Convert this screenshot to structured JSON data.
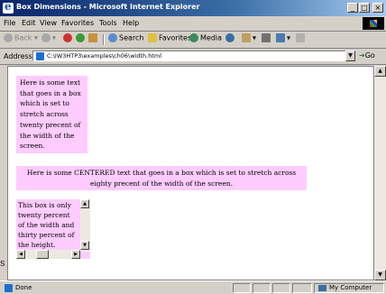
{
  "window": {
    "title": "Box Dimensions - Microsoft Internet Explorer",
    "controls": {
      "minimize": "_",
      "maximize": "□",
      "close": "×"
    }
  },
  "menu": [
    "File",
    "Edit",
    "View",
    "Favorites",
    "Tools",
    "Help"
  ],
  "toolbar": {
    "back": "Back",
    "search": "Search",
    "favorites": "Favorites",
    "media": "Media"
  },
  "address": {
    "label": "Address",
    "url": "C:\\IW3HTP3\\examples\\ch06\\width.html",
    "go": "Go"
  },
  "content": {
    "box1_text": "Here is some text that goes in a box which is set to stretch across twenty precent of the width of the screen.",
    "box2_text": "Here is some CENTERED text that goes in a box which is set to stretch across eighty precent of the width of the screen.",
    "box3_text": "This box is only twenty percent of the width and thirty percent of the height.",
    "margin_text": "S"
  },
  "status": {
    "text": "Done",
    "zone": "My Computer"
  },
  "colors": {
    "box_background": "#ffccff",
    "titlebar": "#0a246a"
  }
}
